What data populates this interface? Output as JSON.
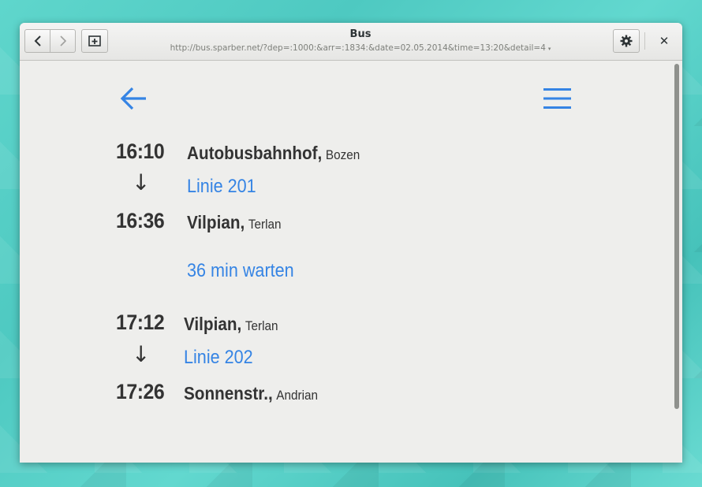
{
  "window": {
    "title": "Bus",
    "url": "http://bus.sparber.net/?dep=:1000:&arr=:1834:&date=02.05.2014&time=13:20&detail=4",
    "url_caret": "▾",
    "close_glyph": "✕"
  },
  "icons": {
    "back": "back-arrow-icon",
    "forward": "forward-arrow-icon",
    "new_tab": "new-tab-icon",
    "settings": "gear-icon",
    "close": "close-icon",
    "page_back": "left-arrow-icon",
    "menu": "hamburger-menu-icon",
    "down": "down-arrow-icon"
  },
  "colors": {
    "accent": "#3584e4",
    "text": "#333333",
    "page_bg": "#eeeeec"
  },
  "journey": {
    "leg1": {
      "dep_time": "16:10",
      "dep_stop": "Autobusbahnhof,",
      "dep_place": "Bozen",
      "line": "Linie 201",
      "arr_time": "16:36",
      "arr_stop": "Vilpian,",
      "arr_place": "Terlan"
    },
    "wait": "36 min warten",
    "leg2": {
      "dep_time": "17:12",
      "dep_stop": "Vilpian,",
      "dep_place": "Terlan",
      "line": "Linie 202",
      "arr_time": "17:26",
      "arr_stop": "Sonnenstr.,",
      "arr_place": "Andrian"
    },
    "arrow_glyph": "↓"
  }
}
